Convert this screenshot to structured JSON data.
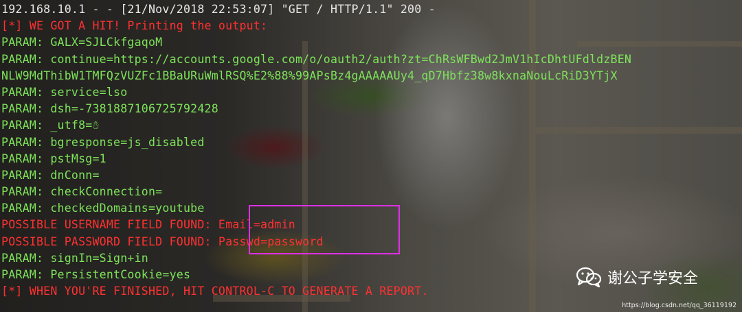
{
  "terminal": {
    "lines": [
      {
        "text": "192.168.10.1 - - [21/Nov/2018 22:53:07] \"GET / HTTP/1.1\" 200 -",
        "color": "white"
      },
      {
        "text": "[*] WE GOT A HIT! Printing the output:",
        "color": "red"
      },
      {
        "text": "PARAM: GALX=SJLCkfgaqoM",
        "color": "green"
      },
      {
        "text": "PARAM: continue=https://accounts.google.com/o/oauth2/auth?zt=ChRsWFBwd2JmV1hIcDhtUFdldzBEN",
        "color": "green"
      },
      {
        "text": "NLW9MdThibW1TMFQzVUZFc1BBaURuWmlRSQ%E2%88%99APsBz4gAAAAAUy4_qD7Hbfz38w8kxnaNouLcRiD3YTjX",
        "color": "green"
      },
      {
        "text": "PARAM: service=lso",
        "color": "green"
      },
      {
        "text": "PARAM: dsh=-7381887106725792428",
        "color": "green"
      },
      {
        "text": "PARAM: _utf8=☃",
        "color": "green"
      },
      {
        "text": "PARAM: bgresponse=js_disabled",
        "color": "green"
      },
      {
        "text": "PARAM: pstMsg=1",
        "color": "green"
      },
      {
        "text": "PARAM: dnConn=",
        "color": "green"
      },
      {
        "text": "PARAM: checkConnection=",
        "color": "green"
      },
      {
        "text": "PARAM: checkedDomains=youtube",
        "color": "green"
      },
      {
        "text": "POSSIBLE USERNAME FIELD FOUND: Email=admin",
        "color": "red"
      },
      {
        "text": "POSSIBLE PASSWORD FIELD FOUND: Passwd=password",
        "color": "red"
      },
      {
        "text": "PARAM: signIn=Sign+in",
        "color": "green"
      },
      {
        "text": "PARAM: PersistentCookie=yes",
        "color": "green"
      },
      {
        "text": "[*] WHEN YOU'RE FINISHED, HIT CONTROL-C TO GENERATE A REPORT.",
        "color": "red"
      }
    ]
  },
  "colors": {
    "white": "#e6e6e6",
    "red": "#ff3131",
    "green": "#7ee35a",
    "highlight": "#e02ee6"
  },
  "watermark": {
    "text": "谢公子学安全",
    "icon": "wechat-icon"
  },
  "small_watermark": {
    "text": "https://blog.csdn.net/qq_36119192"
  }
}
